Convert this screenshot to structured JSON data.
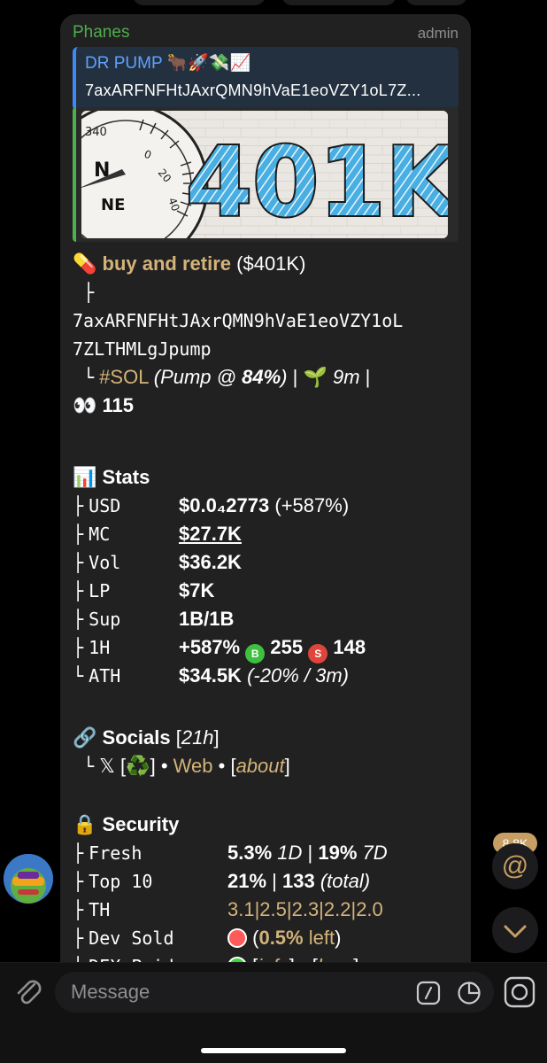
{
  "post": {
    "sender": "Phanes",
    "role": "admin",
    "reply": {
      "title": "DR PUMP 🐂🚀💸📈",
      "text": "7axARFNFHtJAxrQMN9hVaE1eoVZY1oL7Z..."
    },
    "image_text": "401K",
    "token": {
      "icon": "💊",
      "name": "buy and retire",
      "price_paren": "($401K)",
      "branch1": "├",
      "address_line1": "7axARFNFHtJAxrQMN9hVaE1eoVZY1oL",
      "address_line2": "7ZLTHMLgJpump",
      "end1": "└",
      "chain": "#SOL",
      "pump_pre": "(Pump @ ",
      "pump_pct": "84%",
      "pump_post": ")",
      "sep1": "|",
      "age_icon": "🌱",
      "age": "9m",
      "sep2": "|",
      "eyes_icon": "👀",
      "eyes_count": "115"
    },
    "stats": {
      "icon": "📊",
      "title": "Stats",
      "rows": [
        {
          "branch": "├",
          "key": "USD",
          "value": "$0.0₄2773",
          "extra": "(+587%)"
        },
        {
          "branch": "├",
          "key": "MC",
          "value": "$27.7K"
        },
        {
          "branch": "├",
          "key": "Vol",
          "value": "$36.2K"
        },
        {
          "branch": "├",
          "key": "LP",
          "value": "$7K"
        },
        {
          "branch": "├",
          "key": "Sup",
          "value": "1B/1B"
        },
        {
          "branch": "├",
          "key": "1H",
          "value": "+587%",
          "buy_letter": "B",
          "buy_count": "255",
          "sell_letter": "S",
          "sell_count": "148"
        },
        {
          "branch": "└",
          "key": "ATH",
          "value": "$34.5K",
          "extra": "(-20% / 3m)"
        }
      ]
    },
    "socials": {
      "icon": "🔗",
      "title": "Socials",
      "age": "21h",
      "branch": "└",
      "x_label": "𝕏",
      "x_icon": "♻️",
      "sep": "•",
      "web": "Web",
      "about": "about"
    },
    "security": {
      "icon": "🔒",
      "title": "Security",
      "rows": [
        {
          "branch": "├",
          "key": "Fresh",
          "value": "5.3%",
          "p1": "1D",
          "sep": "|",
          "value2": "19%",
          "p2": "7D"
        },
        {
          "branch": "├",
          "key": "Top 10",
          "value": "21%",
          "sep": "|",
          "value2": "133",
          "p2": "(total)"
        },
        {
          "branch": "├",
          "key": "TH",
          "value": "3.1|2.5|2.3|2.2|2.0"
        },
        {
          "branch": "├",
          "key": "Dev Sold",
          "value": "0.5%",
          "suffix": "left"
        },
        {
          "branch": "└",
          "key": "DEX Paid",
          "info": "info",
          "sep": "•",
          "lens": "lens"
        }
      ]
    }
  },
  "side": {
    "mention_count": "8.8K",
    "mention_symbol": "@"
  },
  "composer": {
    "placeholder": "Message"
  },
  "colors": {
    "accent_gold": "#d4b37a",
    "sender_green": "#4fae4e",
    "link_blue": "#5ea2ff",
    "buy_green": "#3fbf3f",
    "sell_red": "#e0453b"
  }
}
